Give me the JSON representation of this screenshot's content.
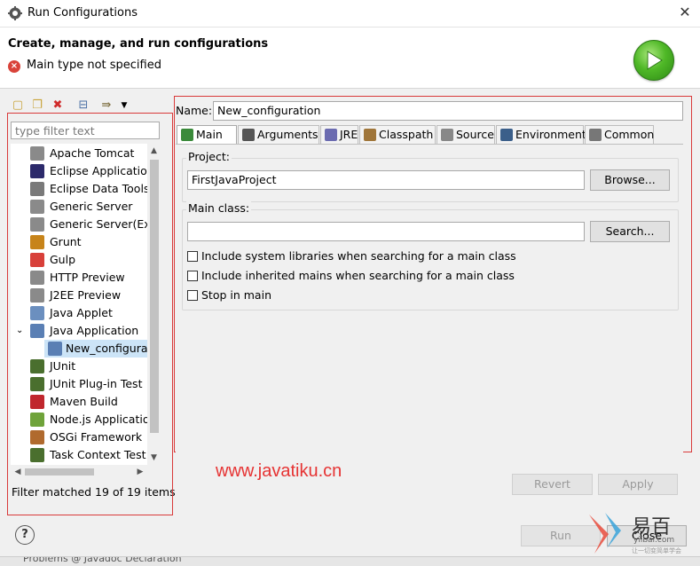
{
  "window": {
    "title": "Run Configurations",
    "close_glyph": "✕"
  },
  "header": {
    "heading": "Create, manage, and run configurations",
    "message": "Main type not specified",
    "error_icon": "error-icon"
  },
  "left": {
    "filter_placeholder": "type filter text",
    "tree": [
      {
        "label": "Apache Tomcat",
        "icon": "server-icon",
        "color": "#8a8a8a"
      },
      {
        "label": "Eclipse Application",
        "icon": "eclipse-icon",
        "color": "#2c2a6b"
      },
      {
        "label": "Eclipse Data Tools",
        "icon": "database-icon",
        "color": "#7a7a7a"
      },
      {
        "label": "Generic Server",
        "icon": "server-icon",
        "color": "#8a8a8a"
      },
      {
        "label": "Generic Server(Exte",
        "icon": "server-icon",
        "color": "#8a8a8a"
      },
      {
        "label": "Grunt",
        "icon": "grunt-icon",
        "color": "#c7841a"
      },
      {
        "label": "Gulp",
        "icon": "gulp-icon",
        "color": "#d8403a"
      },
      {
        "label": "HTTP Preview",
        "icon": "server-icon",
        "color": "#8a8a8a"
      },
      {
        "label": "J2EE Preview",
        "icon": "server-icon",
        "color": "#8a8a8a"
      },
      {
        "label": "Java Applet",
        "icon": "applet-icon",
        "color": "#6b8fbf"
      },
      {
        "label": "Java Application",
        "icon": "java-app-icon",
        "color": "#5a7fb4",
        "expanded": true
      },
      {
        "label": "New_configuration",
        "icon": "java-app-icon",
        "color": "#5a7fb4",
        "child": true,
        "selected": true
      },
      {
        "label": "JUnit",
        "icon": "junit-icon",
        "color": "#4a6f2e"
      },
      {
        "label": "JUnit Plug-in Test",
        "icon": "junit-icon",
        "color": "#4a6f2e"
      },
      {
        "label": "Maven Build",
        "icon": "maven-icon",
        "color": "#c0272d"
      },
      {
        "label": "Node.js Application",
        "icon": "nodejs-icon",
        "color": "#6fa33a"
      },
      {
        "label": "OSGi Framework",
        "icon": "osgi-icon",
        "color": "#b06a2e"
      },
      {
        "label": "Task Context Test",
        "icon": "junit-icon",
        "color": "#4a6f2e"
      }
    ],
    "filter_status": "Filter matched 19 of 19 items"
  },
  "right": {
    "name_label": "Name:",
    "name_value": "New_configuration",
    "tabs": [
      {
        "label": "Main",
        "icon": "main-tab-icon",
        "color": "#3a8a3a",
        "active": true
      },
      {
        "label": "Arguments",
        "icon": "arguments-tab-icon",
        "color": "#555"
      },
      {
        "label": "JRE",
        "icon": "jre-tab-icon",
        "color": "#6b6bb0"
      },
      {
        "label": "Classpath",
        "icon": "classpath-tab-icon",
        "color": "#a0763a"
      },
      {
        "label": "Source",
        "icon": "source-tab-icon",
        "color": "#888"
      },
      {
        "label": "Environment",
        "icon": "environment-tab-icon",
        "color": "#3b5f8a"
      },
      {
        "label": "Common",
        "icon": "common-tab-icon",
        "color": "#777"
      }
    ],
    "project_label": "Project:",
    "project_value": "FirstJavaProject",
    "browse_label": "Browse...",
    "mainclass_label": "Main class:",
    "mainclass_value": "",
    "search_label": "Search...",
    "checkboxes": [
      {
        "label": "Include system libraries when searching for a main class",
        "checked": false
      },
      {
        "label": "Include inherited mains when searching for a main class",
        "checked": false
      },
      {
        "label": "Stop in main",
        "checked": false
      }
    ],
    "revert_label": "Revert",
    "apply_label": "Apply"
  },
  "footer": {
    "run_label": "Run",
    "close_label": "Close",
    "help_glyph": "?"
  },
  "watermark": "www.javatiku.cn",
  "logo_text": "易百",
  "logo_sub": "yiibai.com",
  "logo_tag": "让一切变简单学会",
  "background_tabs": "Problems   @ Javadoc   Declaration"
}
